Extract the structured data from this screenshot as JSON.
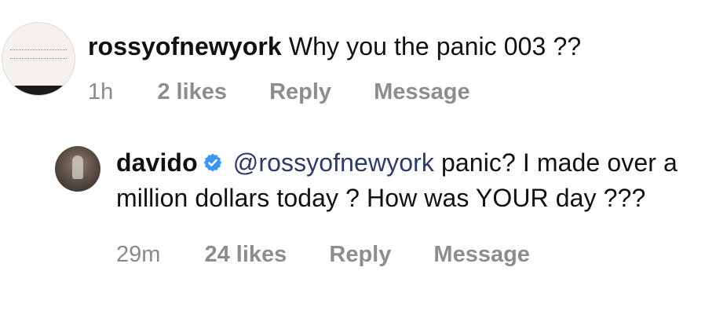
{
  "comments": [
    {
      "username": "rossyofnewyork",
      "text": "Why you the panic 003 ??",
      "time": "1h",
      "likes": "2 likes",
      "reply_label": "Reply",
      "message_label": "Message"
    },
    {
      "username": "davido",
      "verified": true,
      "mention": "@rossyofnewyork",
      "text": "panic? I made over a million dollars today ? How was YOUR day ???",
      "time": "29m",
      "likes": "24 likes",
      "reply_label": "Reply",
      "message_label": "Message"
    }
  ],
  "icons": {
    "verified_badge": "verified-badge-icon"
  },
  "colors": {
    "text": "#111111",
    "muted": "#8a8a8a",
    "verified_blue": "#3897f0"
  }
}
